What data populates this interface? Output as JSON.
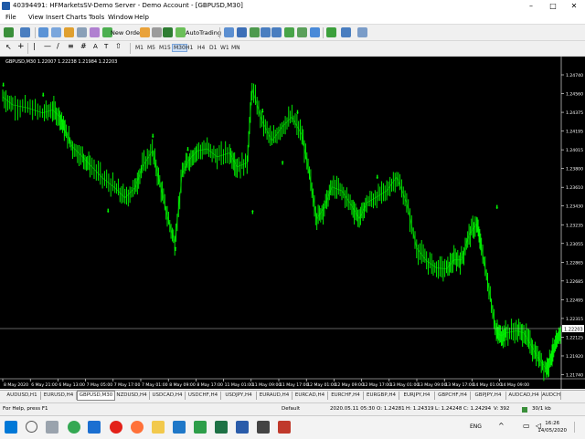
{
  "window": {
    "title": "40394491: HFMarketsSV-Demo Server - Demo Account - [GBPUSD,M30]",
    "controls": [
      "–",
      "□",
      "✕"
    ]
  },
  "menu": [
    "File",
    "View",
    "Insert",
    "Charts",
    "Tools",
    "Window",
    "Help"
  ],
  "toolbar": {
    "new_order": "New Order",
    "autotrading": "AutoTrading",
    "timeframes": [
      "M1",
      "M5",
      "M15",
      "M30",
      "H1",
      "H4",
      "D1",
      "W1",
      "MN"
    ]
  },
  "chart": {
    "ticker": "GBPUSD,M30  1.22007 1.22238 1.21984 1.22203",
    "current_price": "1.22203",
    "colors": {
      "background": "#000000",
      "candles": "#00ff00",
      "axis_text": "#ffffff"
    }
  },
  "chart_data": {
    "type": "line",
    "symbol": "GBPUSD",
    "timeframe": "M30",
    "y_ticks": [
      "1.24740",
      "1.24560",
      "1.24375",
      "1.24195",
      "1.24015",
      "1.23800",
      "1.23610",
      "1.23430",
      "1.23235",
      "1.23055",
      "1.22865",
      "1.22685",
      "1.22495",
      "1.22315",
      "1.22125",
      "1.21920",
      "1.21740"
    ],
    "x_ticks": [
      "8 May 2020",
      "6 May 21:00",
      "6 May 13:00",
      "7 May 05:00",
      "7 May 17:00",
      "7 May 01:00",
      "8 May 09:00",
      "8 May 17:00",
      "11 May 01:00",
      "11 May 09:00",
      "11 May 17:00",
      "12 May 01:00",
      "12 May 09:00",
      "12 May 17:00",
      "13 May 01:00",
      "13 May 09:00",
      "13 May 17:00",
      "14 May 01:00",
      "14 May 09:00"
    ],
    "ylim": [
      1.2171,
      1.2485
    ],
    "price_path": [
      [
        0.0,
        1.2452
      ],
      [
        0.02,
        1.2444
      ],
      [
        0.05,
        1.2441
      ],
      [
        0.08,
        1.2436
      ],
      [
        0.1,
        1.2439
      ],
      [
        0.115,
        1.2432
      ],
      [
        0.125,
        1.2418
      ],
      [
        0.14,
        1.2402
      ],
      [
        0.16,
        1.2392
      ],
      [
        0.175,
        1.2384
      ],
      [
        0.2,
        1.2371
      ],
      [
        0.225,
        1.2361
      ],
      [
        0.245,
        1.2351
      ],
      [
        0.265,
        1.2361
      ],
      [
        0.28,
        1.2382
      ],
      [
        0.3,
        1.2398
      ],
      [
        0.315,
        1.2366
      ],
      [
        0.33,
        1.2333
      ],
      [
        0.345,
        1.2306
      ],
      [
        0.36,
        1.2376
      ],
      [
        0.375,
        1.239
      ],
      [
        0.39,
        1.2398
      ],
      [
        0.41,
        1.24
      ],
      [
        0.43,
        1.2392
      ],
      [
        0.455,
        1.2396
      ],
      [
        0.47,
        1.2382
      ],
      [
        0.49,
        1.2386
      ],
      [
        0.5,
        1.246
      ],
      [
        0.52,
        1.2428
      ],
      [
        0.54,
        1.2408
      ],
      [
        0.56,
        1.2422
      ],
      [
        0.58,
        1.2432
      ],
      [
        0.6,
        1.2414
      ],
      [
        0.615,
        1.2374
      ],
      [
        0.63,
        1.233
      ],
      [
        0.645,
        1.2342
      ],
      [
        0.66,
        1.2362
      ],
      [
        0.68,
        1.2358
      ],
      [
        0.7,
        1.2343
      ],
      [
        0.715,
        1.233
      ],
      [
        0.73,
        1.2346
      ],
      [
        0.75,
        1.2352
      ],
      [
        0.77,
        1.2358
      ],
      [
        0.79,
        1.2372
      ],
      [
        0.81,
        1.2346
      ],
      [
        0.83,
        1.2301
      ],
      [
        0.85,
        1.2288
      ],
      [
        0.87,
        1.2281
      ],
      [
        0.89,
        1.228
      ],
      [
        0.905,
        1.2289
      ],
      [
        0.92,
        1.2289
      ],
      [
        0.935,
        1.2314
      ],
      [
        0.95,
        1.2325
      ],
      [
        0.96,
        1.2302
      ],
      [
        0.975,
        1.226
      ],
      [
        0.99,
        1.2216
      ],
      [
        1.0,
        1.2213
      ],
      [
        1.01,
        1.2216
      ],
      [
        1.03,
        1.2218
      ],
      [
        1.045,
        1.2216
      ],
      [
        1.06,
        1.2203
      ],
      [
        1.075,
        1.219
      ],
      [
        1.09,
        1.218
      ],
      [
        1.1,
        1.2193
      ],
      [
        1.11,
        1.2204
      ],
      [
        1.12,
        1.222
      ]
    ],
    "fractals_up": [
      [
        0.0,
        1.2462
      ],
      [
        0.08,
        1.2452
      ],
      [
        0.21,
        1.2336
      ],
      [
        0.3,
        1.2411
      ],
      [
        0.37,
        1.2398
      ],
      [
        0.52,
        1.2436
      ],
      [
        0.59,
        1.2435
      ],
      [
        0.75,
        1.237
      ],
      [
        0.99,
        1.234
      ]
    ],
    "fractals_down": [
      [
        0.345,
        1.2298
      ],
      [
        0.5,
        1.2335
      ],
      [
        0.56,
        1.2384
      ]
    ]
  },
  "tabs": [
    "AUDUSD,H1",
    "EURUSD,H4",
    "GBPUSD,M30",
    "NZDUSD,H4",
    "USDCAD,H4",
    "USDCHF,H4",
    "USDJPY,H4",
    "EURAUD,H4",
    "EURCAD,H4",
    "EURCHF,H4",
    "EURGBP,H4",
    "EURJPY,H4",
    "GBPCHF,H4",
    "GBPJPY,H4",
    "AUDCAD,H4",
    "AUDCH"
  ],
  "active_tab": 2,
  "status": {
    "help": "For Help, press F1",
    "profile": "Default",
    "time": "2020.05.11 05:30",
    "open": "O: 1.24281",
    "high": "H: 1.24319",
    "low": "L: 1.24248",
    "close": "C: 1.24294",
    "volume": "V: 392",
    "traffic": "30/1 kb"
  },
  "taskbar": {
    "time": "16:26",
    "date": "14/05/2020"
  }
}
